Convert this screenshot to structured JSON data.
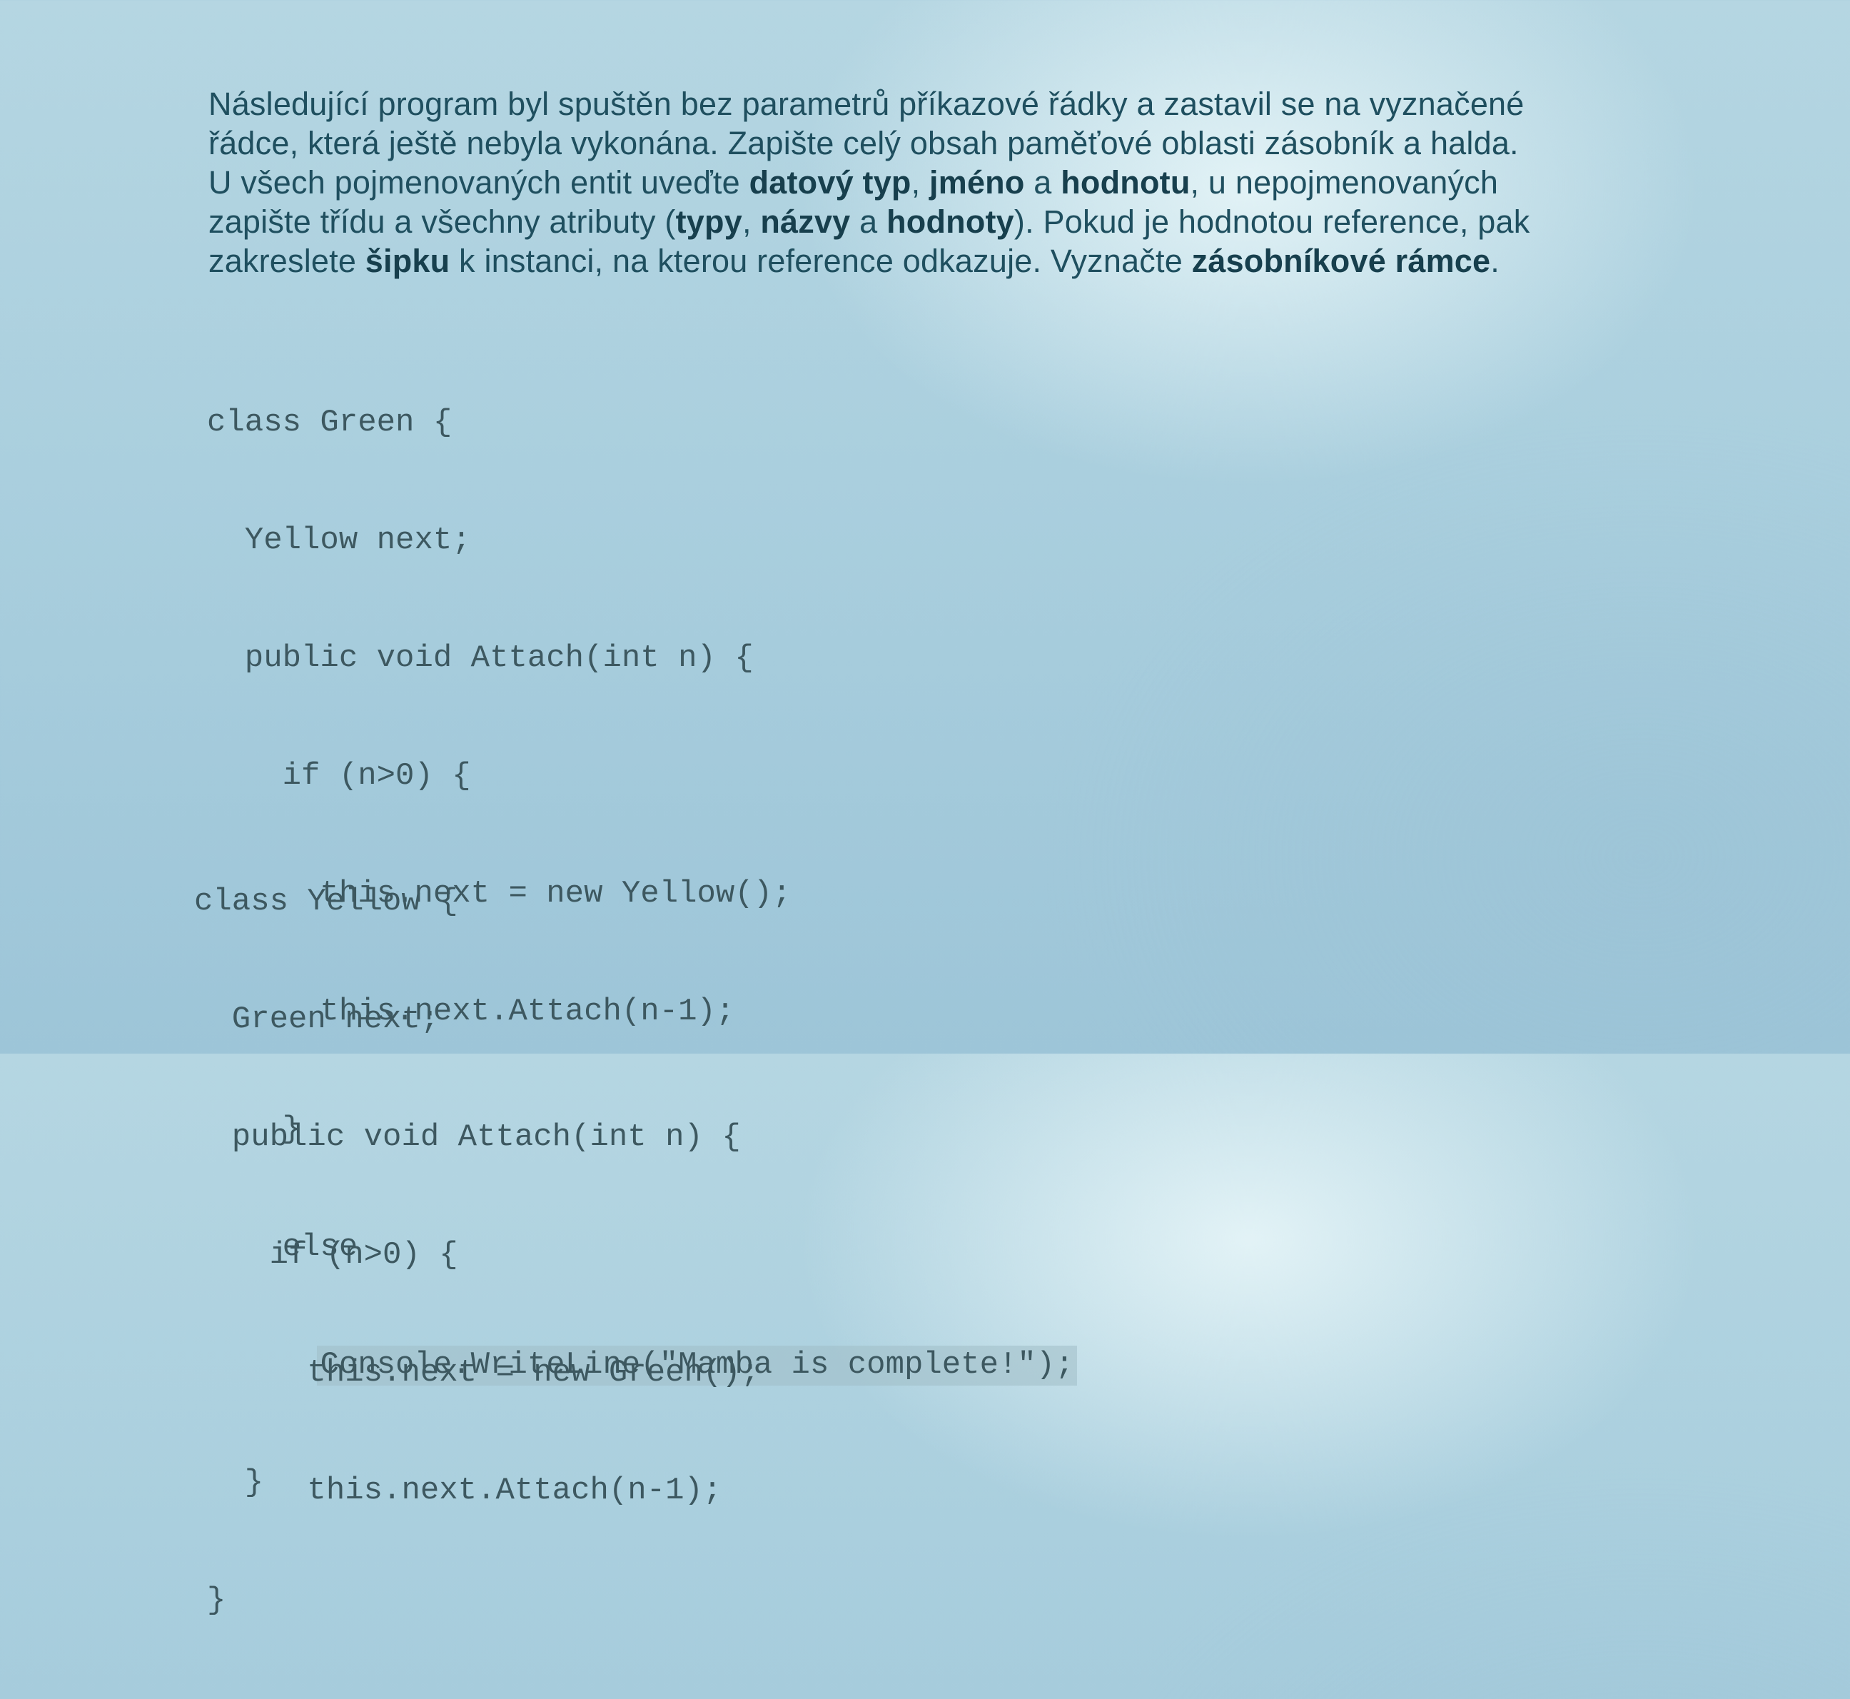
{
  "instructions": {
    "line1": "Následující program byl spuštěn bez parametrů příkazové řádky a zastavil se na vyznačené",
    "line2": "řádce, která ještě nebyla vykonána. Zapište celý obsah paměťové oblasti zásobník a halda.",
    "line3_a": "U všech pojmenovaných entit uveďte ",
    "line3_b": "datový typ",
    "line3_c": ", ",
    "line3_d": "jméno",
    "line3_e": " a ",
    "line3_f": "hodnotu",
    "line3_g": ", u nepojmenovaných",
    "line4_a": "zapište třídu a všechny atributy (",
    "line4_b": "typy",
    "line4_c": ", ",
    "line4_d": "názvy",
    "line4_e": " a ",
    "line4_f": "hodnoty",
    "line4_g": "). Pokud je hodnotou reference, pak",
    "line5_a": "zakreslete ",
    "line5_b": "šipku",
    "line5_c": " k instanci, na kterou reference odkazuje. Vyznačte ",
    "line5_d": "zásobníkové rámce",
    "line5_e": "."
  },
  "code_green": [
    "class Green {",
    "  Yellow next;",
    "  public void Attach(int n) {",
    "    if (n>0) {",
    "      this.next = new Yellow();",
    "      this.next.Attach(n-1);",
    "    }",
    "    else",
    "      Console.WriteLine(\"Mamba is complete!\");",
    "  }",
    "}"
  ],
  "code_yellow": [
    "class Yellow {",
    "  Green next;",
    "  public void Attach(int n) {",
    "    if (n>0) {",
    "      this.next = new Green();",
    "      this.next.Attach(n-1);"
  ],
  "highlighted_line": {
    "indent": "      ",
    "code": "Console.WriteLine(\"Mamba is complete!\");"
  }
}
